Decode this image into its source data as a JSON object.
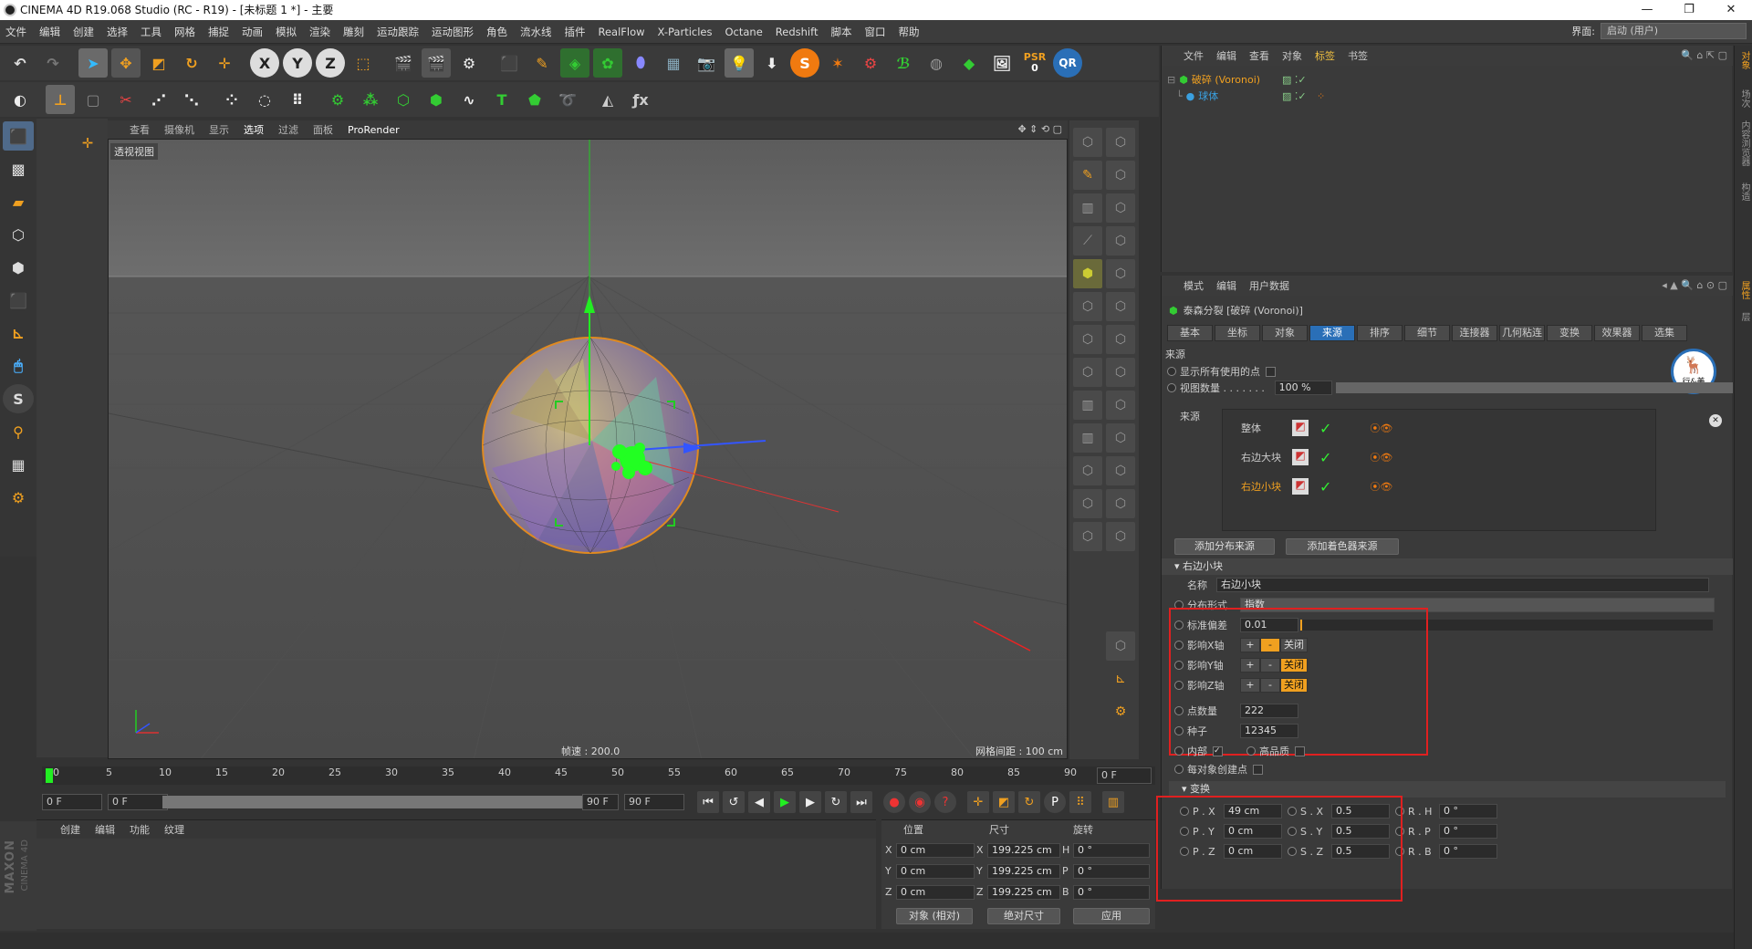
{
  "window": {
    "title": "CINEMA 4D R19.068 Studio (RC - R19) - [未标题 1 *] - 主要",
    "controls": [
      "—",
      "❐",
      "✕"
    ]
  },
  "menubar": {
    "items": [
      "文件",
      "编辑",
      "创建",
      "选择",
      "工具",
      "网格",
      "捕捉",
      "动画",
      "模拟",
      "渲染",
      "雕刻",
      "运动跟踪",
      "运动图形",
      "角色",
      "流水线",
      "插件",
      "RealFlow",
      "X-Particles",
      "Octane",
      "Redshift",
      "脚本",
      "窗口",
      "帮助"
    ],
    "layout_label": "界面:",
    "layout_value": "启动 (用户)"
  },
  "toolbar1": {
    "buttons": [
      "undo-icon",
      "redo-icon",
      "select-icon",
      "move-icon",
      "scale-icon",
      "rotate-icon",
      "axis-icon",
      "x-lock",
      "y-lock",
      "z-lock",
      "coord-system-icon",
      "render-view-icon",
      "render-picture-icon",
      "render-settings-icon",
      "cube-icon",
      "pen-icon",
      "subdivision-icon",
      "cloner-icon",
      "deformer-icon",
      "floor-icon",
      "camera-icon",
      "light-icon",
      "download-icon",
      "s-icon",
      "particles-icon",
      "xp-icon",
      "redshift-icon",
      "realflow-icon",
      "octane-icon",
      "psr-icon",
      "qr-icon"
    ],
    "xyz": [
      "X",
      "Y",
      "Z"
    ],
    "psr_label": "PSR",
    "psr_value": "0",
    "qr_label": "QR"
  },
  "viewport": {
    "menu": [
      "查看",
      "摄像机",
      "显示",
      "选项",
      "过滤",
      "面板",
      "ProRender"
    ],
    "active_menu": "选项",
    "label": "透视视图",
    "fps": "帧速 : 200.0",
    "grid": "网格间距 : 100 cm"
  },
  "timeline": {
    "ticks": [
      "0",
      "5",
      "10",
      "15",
      "20",
      "25",
      "30",
      "35",
      "40",
      "45",
      "50",
      "55",
      "60",
      "65",
      "70",
      "75",
      "80",
      "85",
      "90"
    ],
    "current": "0 F"
  },
  "transport": {
    "start": "0 F",
    "range_start": "0 F",
    "range_end": "90 F",
    "end": "90 F"
  },
  "material": {
    "menu": [
      "创建",
      "编辑",
      "功能",
      "纹理"
    ],
    "logo": "MAXON",
    "logo2": "CINEMA 4D"
  },
  "coords": {
    "headers": [
      "位置",
      "尺寸",
      "旋转"
    ],
    "rows": [
      {
        "a": "X",
        "pos": "0 cm",
        "s": "X",
        "size": "199.225 cm",
        "r": "H",
        "rot": "0 °"
      },
      {
        "a": "Y",
        "pos": "0 cm",
        "s": "Y",
        "size": "199.225 cm",
        "r": "P",
        "rot": "0 °"
      },
      {
        "a": "Z",
        "pos": "0 cm",
        "s": "Z",
        "size": "199.225 cm",
        "r": "B",
        "rot": "0 °"
      }
    ],
    "mode1": "对象 (相对)",
    "mode2": "绝对尺寸",
    "apply": "应用"
  },
  "objmgr": {
    "menu": [
      "文件",
      "编辑",
      "查看",
      "对象",
      "标签",
      "书签"
    ],
    "active": "标签",
    "objects": [
      {
        "name": "破碎 (Voronoi)",
        "color": "#f0a020"
      },
      {
        "name": "球体",
        "color": "#3aa0e0"
      }
    ]
  },
  "attrmgr": {
    "menu": [
      "模式",
      "编辑",
      "用户数据"
    ],
    "object_title": "泰森分裂 [破碎 (Voronoi)]",
    "tabs": [
      "基本",
      "坐标",
      "对象",
      "来源",
      "排序",
      "细节",
      "连接器",
      "几何粘连",
      "变换",
      "效果器",
      "选集"
    ],
    "active_tab": "来源",
    "section_source": "来源",
    "show_points": "显示所有使用的点",
    "viewport_count_label": "视图数量 . . . . . . .",
    "viewport_count": "100 %",
    "source_label": "来源",
    "sources": [
      {
        "name": "整体",
        "active": false
      },
      {
        "name": "右边大块",
        "active": false
      },
      {
        "name": "右边小块",
        "active": true
      }
    ],
    "add_dist": "添加分布来源",
    "add_shader": "添加着色器来源",
    "sub_section": "右边小块",
    "name_label": "名称",
    "name_value": "右边小块",
    "distribution_label": "分布形式",
    "distribution_value": "指数",
    "stddev_label": "标准偏差",
    "stddev_value": "0.01",
    "affect_x": "影响X轴",
    "affect_y": "影响Y轴",
    "affect_z": "影响Z轴",
    "plus": "+",
    "minus": "-",
    "off_label": "关闭",
    "points_label": "点数量",
    "points_value": "222",
    "seed_label": "种子",
    "seed_value": "12345",
    "inside_label": "内部",
    "hq_label": "高品质",
    "per_object_label": "每对象创建点",
    "transform_section": "变换",
    "transform": [
      {
        "l1": "P . X",
        "v1": "49 cm",
        "l2": "S . X",
        "v2": "0.5",
        "l3": "R . H",
        "v3": "0 °"
      },
      {
        "l1": "P . Y",
        "v1": "0 cm",
        "l2": "S . Y",
        "v2": "0.5",
        "l3": "R . P",
        "v3": "0 °"
      },
      {
        "l1": "P . Z",
        "v1": "0 cm",
        "l2": "S . Z",
        "v2": "0.5",
        "l3": "R . B",
        "v3": "0 °"
      }
    ],
    "badge": "行&美"
  },
  "rightside_tabs": [
    "对象",
    "场次",
    "内容浏览器",
    "构造",
    "属性",
    "层"
  ],
  "colors": {
    "accent": "#f0a020",
    "tab_active": "#2a6fb7",
    "highlight": "#e02020"
  }
}
